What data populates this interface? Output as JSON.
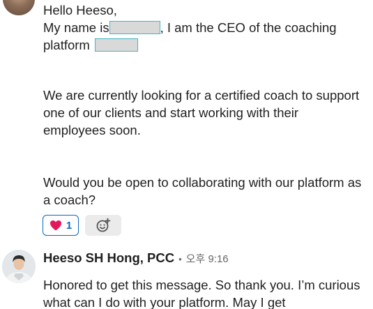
{
  "message_1": {
    "greeting": "Hello Heeso,",
    "intro_prefix": "My name is",
    "intro_suffix": ", I am the CEO of the coaching",
    "platform_label": "platform",
    "paragraph_2": "We are currently looking for a certified coach to support one of our clients and start working with their employees soon.",
    "paragraph_3": "Would you be open to collaborating with our platform as a coach?",
    "reactions": {
      "heart_count": "1",
      "heart_icon": "heart-icon",
      "add_icon": "add-reaction-icon"
    }
  },
  "message_2": {
    "sender_name": "Heeso SH Hong, PCC",
    "separator": "•",
    "time": "오후 9:16",
    "text": "Honored to get this message. So thank you. I’m curious what can I do with your platform. May I get"
  },
  "colors": {
    "accent": "#0a66c2",
    "redaction_border": "#47b3c4",
    "redaction_fill": "#d9d9d9",
    "heart": "#e3175b"
  }
}
